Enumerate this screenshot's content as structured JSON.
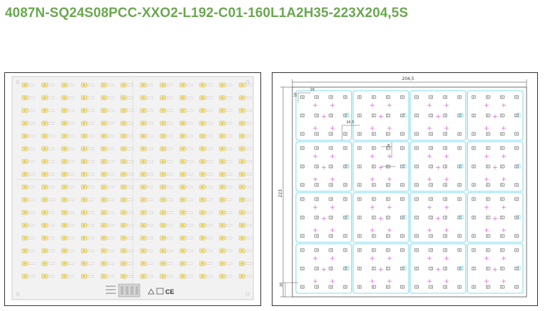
{
  "product": {
    "title": "4087N-SQ24S08PCC-XXO2-L192-C01-160L1A2H35-223X204,5S"
  },
  "photo": {
    "led_rows": 16,
    "led_cols": 12,
    "marks": [
      "CE"
    ],
    "colors": {
      "board": "#f2f2f2",
      "trace": "#d9d9d9",
      "led": "#f2e6a0",
      "led_core": "#e6c84a"
    }
  },
  "drawing": {
    "dim_width": "204,5",
    "dim_height": "223",
    "dim_col_pitch": "16",
    "dim_row_pitch": "10",
    "dim_spacing": "16,5",
    "dim_gap": "8",
    "dim_offset": "20",
    "colors": {
      "outline": "#5ad1e6",
      "cross": "#e05bd8",
      "line": "#333333"
    }
  }
}
